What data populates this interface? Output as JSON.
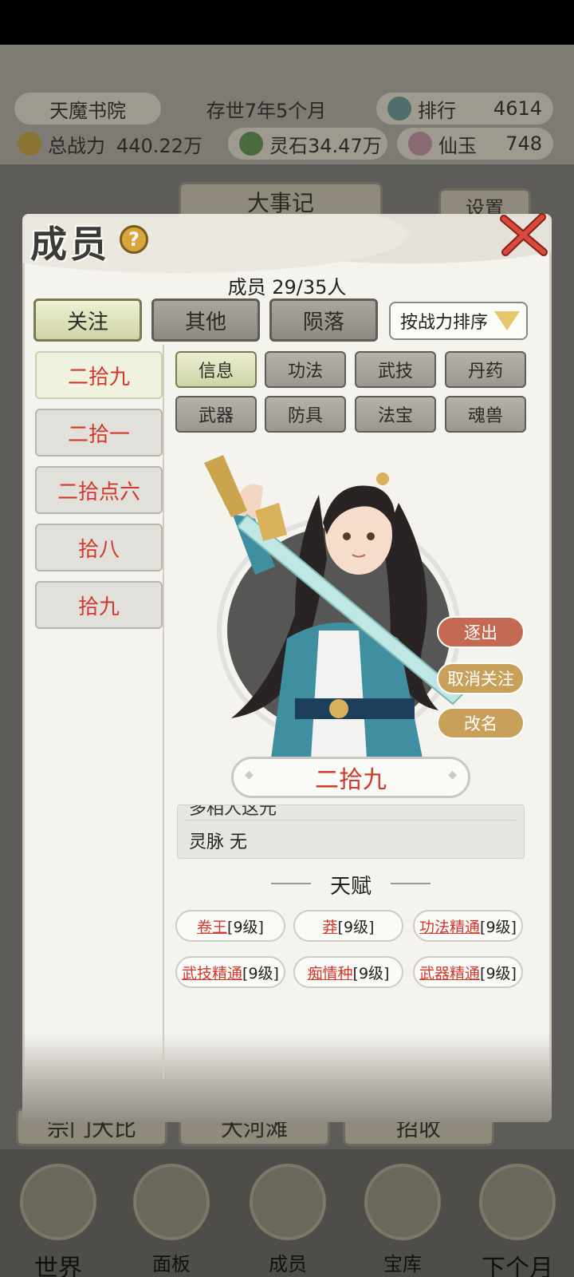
{
  "top_bar": {
    "sect_name": "天魔书院",
    "duration": "存世7年5个月",
    "rank_label": "排行",
    "rank_value": "4614",
    "power_label": "总战力",
    "power_value": "440.22万",
    "stone_label": "灵石",
    "stone_value": "34.47万",
    "jade_label": "仙玉",
    "jade_value": "748"
  },
  "background": {
    "events_label": "大事记",
    "settings_label": "设置",
    "bottom_buttons": [
      "宗门大比",
      "大河滩",
      "招收"
    ]
  },
  "bottom_nav": [
    "世界",
    "面板",
    "成员",
    "宝库",
    "下个月"
  ],
  "modal": {
    "title": "成员",
    "member_count": "成员 29/35人",
    "tabs": [
      {
        "label": "关注",
        "active": true
      },
      {
        "label": "其他",
        "active": false
      },
      {
        "label": "陨落",
        "active": false
      }
    ],
    "sort_label": "按战力排序",
    "members": [
      {
        "name": "二拾九",
        "active": true
      },
      {
        "name": "二拾一",
        "active": false
      },
      {
        "name": "二拾点六",
        "active": false
      },
      {
        "name": "拾八",
        "active": false
      },
      {
        "name": "拾九",
        "active": false
      }
    ],
    "subtabs": [
      "信息",
      "功法",
      "武技",
      "丹药",
      "武器",
      "防具",
      "法宝",
      "魂兽"
    ],
    "actions": {
      "expel": "逐出",
      "unfollow": "取消关注",
      "rename": "改名"
    },
    "selected_name": "二拾九",
    "info_partial": "多相人这元",
    "spirit_vein": "灵脉 无",
    "talent_title": "天赋",
    "talents": [
      {
        "name": "卷王",
        "level": "[9级]"
      },
      {
        "name": "莽",
        "level": "[9级]"
      },
      {
        "name": "功法精通",
        "level": "[9级]"
      },
      {
        "name": "武技精通",
        "level": "[9级]"
      },
      {
        "name": "痴情种",
        "level": "[9级]"
      },
      {
        "name": "武器精通",
        "level": "[9级]"
      }
    ]
  },
  "colors": {
    "accent_red": "#d2382c",
    "active_tab": "#cfd4a7",
    "panel": "#f4f3ee"
  }
}
